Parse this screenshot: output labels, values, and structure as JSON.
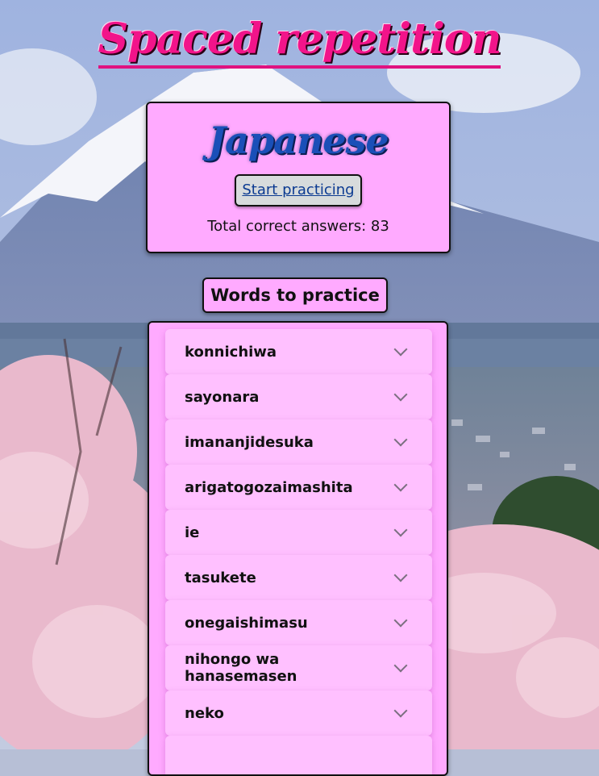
{
  "site_title": "Spaced repetition",
  "language": {
    "name": "Japanese",
    "start_button": "Start practicing",
    "total_label": "Total correct answers: 83"
  },
  "words_heading": "Words to practice",
  "words": [
    "konnichiwa",
    "sayonara",
    "imananjidesuka",
    "arigatogozaimashita",
    "ie",
    "tasukete",
    "onegaishimasu",
    "nihongo wa hanasemasen",
    "neko"
  ],
  "icons": {
    "expand": "chevron-down-icon"
  },
  "colors": {
    "title": "#f2148a",
    "card_bg": "#ffaaff",
    "word_bg": "#ffc0ff",
    "language_name": "#1a4fb8",
    "link": "#0b3a91"
  }
}
